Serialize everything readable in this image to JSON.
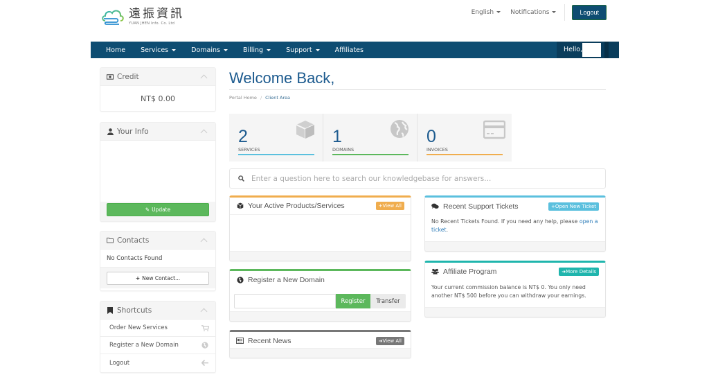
{
  "brand": {
    "name_cn": "遠振資訊",
    "name_en": "YUAN JHEN Info. Co. Ltd"
  },
  "topnav": {
    "language": "English",
    "notifications": "Notifications",
    "logout": "Logout"
  },
  "mainnav": {
    "items": [
      {
        "label": "Home",
        "dropdown": false
      },
      {
        "label": "Services",
        "dropdown": true
      },
      {
        "label": "Domains",
        "dropdown": true
      },
      {
        "label": "Billing",
        "dropdown": true
      },
      {
        "label": "Support",
        "dropdown": true
      },
      {
        "label": "Affiliates",
        "dropdown": false
      }
    ],
    "hello": "Hello,"
  },
  "sidebar": {
    "credit": {
      "title": "Credit",
      "icon": "money-icon",
      "amount": "NT$ 0.00"
    },
    "your_info": {
      "title": "Your Info",
      "icon": "user-icon",
      "update_label": "Update"
    },
    "contacts": {
      "title": "Contacts",
      "icon": "folder-icon",
      "empty_text": "No Contacts Found",
      "new_contact_label": "New Contact..."
    },
    "shortcuts": {
      "title": "Shortcuts",
      "icon": "bookmark-icon",
      "items": [
        {
          "label": "Order New Services",
          "icon": "cart-icon"
        },
        {
          "label": "Register a New Domain",
          "icon": "globe-icon"
        },
        {
          "label": "Logout",
          "icon": "arrow-left-icon"
        }
      ]
    }
  },
  "main": {
    "title": "Welcome Back,",
    "breadcrumb": [
      "Portal Home",
      "Client Area"
    ],
    "tiles": [
      {
        "count": "2",
        "label": "SERVICES",
        "icon": "cube-icon",
        "color": "#5bc0de"
      },
      {
        "count": "1",
        "label": "DOMAINS",
        "icon": "globe-icon",
        "color": "#5cb85c"
      },
      {
        "count": "0",
        "label": "INVOICES",
        "icon": "credit-card-icon",
        "color": "#f0ad4e"
      }
    ],
    "kb_search": {
      "placeholder": "Enter a question here to search our knowledgebase for answers..."
    },
    "panels": {
      "products": {
        "title": "Your Active Products/Services",
        "button": "View All",
        "color": "#f0ad4e"
      },
      "register_domain": {
        "title": "Register a New Domain",
        "register_label": "Register",
        "transfer_label": "Transfer",
        "color": "#5cb85c"
      },
      "news": {
        "title": "Recent News",
        "button": "View All",
        "color": "#777777"
      },
      "tickets": {
        "title": "Recent Support Tickets",
        "button": "Open New Ticket",
        "body_text": "No Recent Tickets Found. If you need any help, please ",
        "body_link": "open a ticket",
        "body_end": ".",
        "color": "#5bc0de"
      },
      "affiliate": {
        "title": "Affiliate Program",
        "button": "More Details",
        "body_text": "Your current commission balance is NT$ 0. You only need another NT$ 500 before you can withdraw your earnings.",
        "color": "#1fb5ad"
      }
    }
  }
}
